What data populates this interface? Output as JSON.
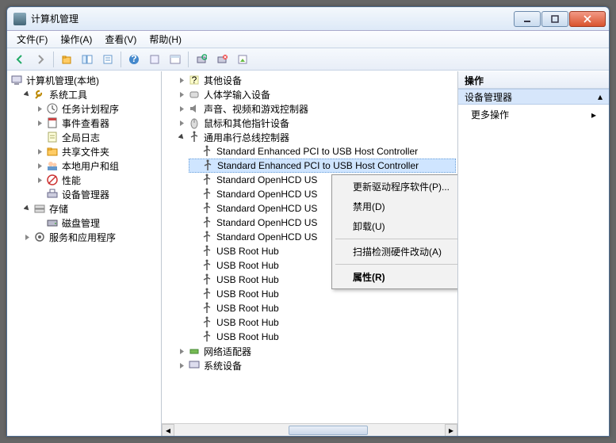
{
  "window": {
    "title": "计算机管理"
  },
  "menu": {
    "file": "文件(F)",
    "action": "操作(A)",
    "view": "查看(V)",
    "help": "帮助(H)"
  },
  "left_tree": {
    "root": "计算机管理(本地)",
    "sys_tools": "系统工具",
    "task_scheduler": "任务计划程序",
    "event_viewer": "事件查看器",
    "global_log": "全局日志",
    "shared_folders": "共享文件夹",
    "local_users": "本地用户和组",
    "performance": "性能",
    "device_manager": "设备管理器",
    "storage": "存储",
    "disk_mgmt": "磁盘管理",
    "services": "服务和应用程序"
  },
  "mid_tree": {
    "other_devices": "其他设备",
    "hid": "人体学输入设备",
    "sound": "声音、视频和游戏控制器",
    "mouse": "鼠标和其他指针设备",
    "usb_controllers": "通用串行总线控制器",
    "usb_items": [
      "Standard Enhanced PCI to USB Host Controller",
      "Standard Enhanced PCI to USB Host Controller",
      "Standard OpenHCD US",
      "Standard OpenHCD US",
      "Standard OpenHCD US",
      "Standard OpenHCD US",
      "Standard OpenHCD US",
      "USB Root Hub",
      "USB Root Hub",
      "USB Root Hub",
      "USB Root Hub",
      "USB Root Hub",
      "USB Root Hub",
      "USB Root Hub"
    ],
    "network": "网络适配器",
    "system_devices": "系统设备"
  },
  "context": {
    "update": "更新驱动程序软件(P)...",
    "disable": "禁用(D)",
    "uninstall": "卸载(U)",
    "scan": "扫描检测硬件改动(A)",
    "properties": "属性(R)"
  },
  "actions": {
    "title": "操作",
    "section": "设备管理器",
    "more": "更多操作"
  },
  "selected_index": 1
}
